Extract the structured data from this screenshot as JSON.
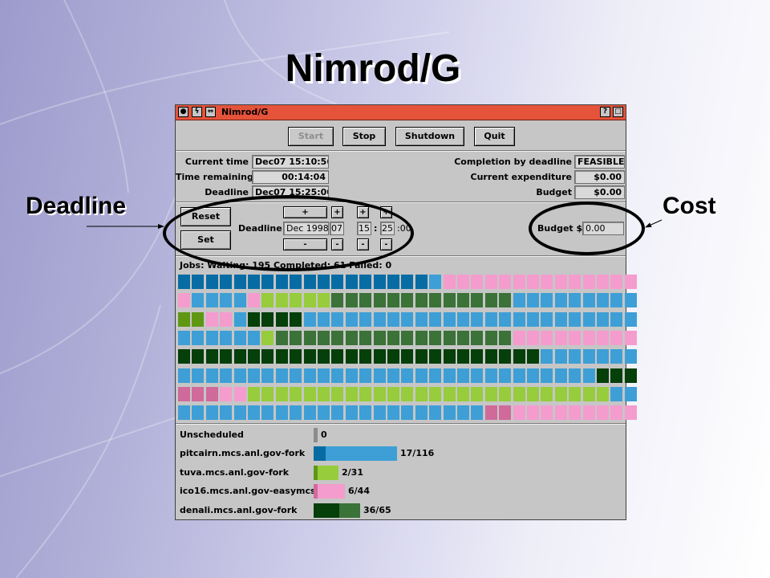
{
  "slide": {
    "title": "Nimrod/G",
    "callouts": {
      "deadline": "Deadline",
      "cost": "Cost"
    }
  },
  "window": {
    "title": "Nimrod/G",
    "icons": [
      "close-icon",
      "lightning-icon",
      "resize-icon",
      "help-icon",
      "maximize-icon"
    ]
  },
  "toolbar": {
    "start": "Start",
    "stop": "Stop",
    "shutdown": "Shutdown",
    "quit": "Quit"
  },
  "status": {
    "current_time_label": "Current time",
    "current_time": "Dec07  15:10:56",
    "time_remaining_label": "Time remaining",
    "time_remaining": "00:14:04",
    "deadline_label": "Deadline",
    "deadline": "Dec07  15:25:00",
    "completion_label": "Completion by deadline",
    "completion": "FEASIBLE",
    "expenditure_label": "Current expenditure",
    "expenditure": "$0.00",
    "budget_label": "Budget",
    "budget": "$0.00"
  },
  "controls": {
    "reset": "Reset",
    "set": "Set",
    "deadline_label": "Deadline",
    "date": "Dec 1998",
    "day": "07",
    "hour": "15",
    "colon": ":",
    "minute": "25",
    "seconds": ":00",
    "plus": "+",
    "minus": "-",
    "budget_label": "Budget $",
    "budget_value": "0.00"
  },
  "jobs": {
    "summary": "Jobs:   Waiting: 195   Completed: 61   Failed: 0",
    "colors": {
      "B": "#086ca4",
      "L": "#3e9fd6",
      "P": "#f49cce",
      "G": "#97cc3c",
      "M": "#3a7238",
      "D": "#053f0a",
      "V": "#d06a9a",
      "O": "#5f9713"
    },
    "rows": [
      "BBBBBBBBBBBBBBBBBBLPPPPPPPPPPPPPP",
      "PLLLLPGGGGGMMMMMMMMMMMMMLLLLLLLLL",
      "OOPPLDDDDLLLLLLLLLLLLLLLLLLLLLLLL",
      "LLLLLLGMMMMMMMMMMMMMMMMMPPPPPPPPP",
      "DDDDDDDDDDDDDDDDDDDDDDDDDDLLLLLLL",
      "LLLLLLLLLLLLLLLLLLLLLLLLLLLLLLDDD",
      "VVVPPGGGGGGGGGGGGGGGGGGGGGGGGGGLL",
      "LLLLLLLLLLLLLLLLLLLLLLVVPPPPPPPPP"
    ]
  },
  "hosts": [
    {
      "name": "Unscheduled",
      "label": "0",
      "segments": [
        {
          "color": "#8c8c8c",
          "value": 1
        }
      ]
    },
    {
      "name": "pitcairn.mcs.anl.gov-fork",
      "label": "17/116",
      "segments": [
        {
          "color": "#086ca4",
          "value": 17
        },
        {
          "color": "#3e9fd6",
          "value": 99
        }
      ]
    },
    {
      "name": "tuva.mcs.anl.gov-fork",
      "label": "2/31",
      "segments": [
        {
          "color": "#5f9713",
          "value": 2
        },
        {
          "color": "#97cc3c",
          "value": 29
        }
      ]
    },
    {
      "name": "ico16.mcs.anl.gov-easymcs",
      "label": "6/44",
      "segments": [
        {
          "color": "#d06a9a",
          "value": 6
        },
        {
          "color": "#f49cce",
          "value": 38
        }
      ]
    },
    {
      "name": "denali.mcs.anl.gov-fork",
      "label": "36/65",
      "segments": [
        {
          "color": "#053f0a",
          "value": 36
        },
        {
          "color": "#3a7238",
          "value": 29
        }
      ]
    }
  ]
}
